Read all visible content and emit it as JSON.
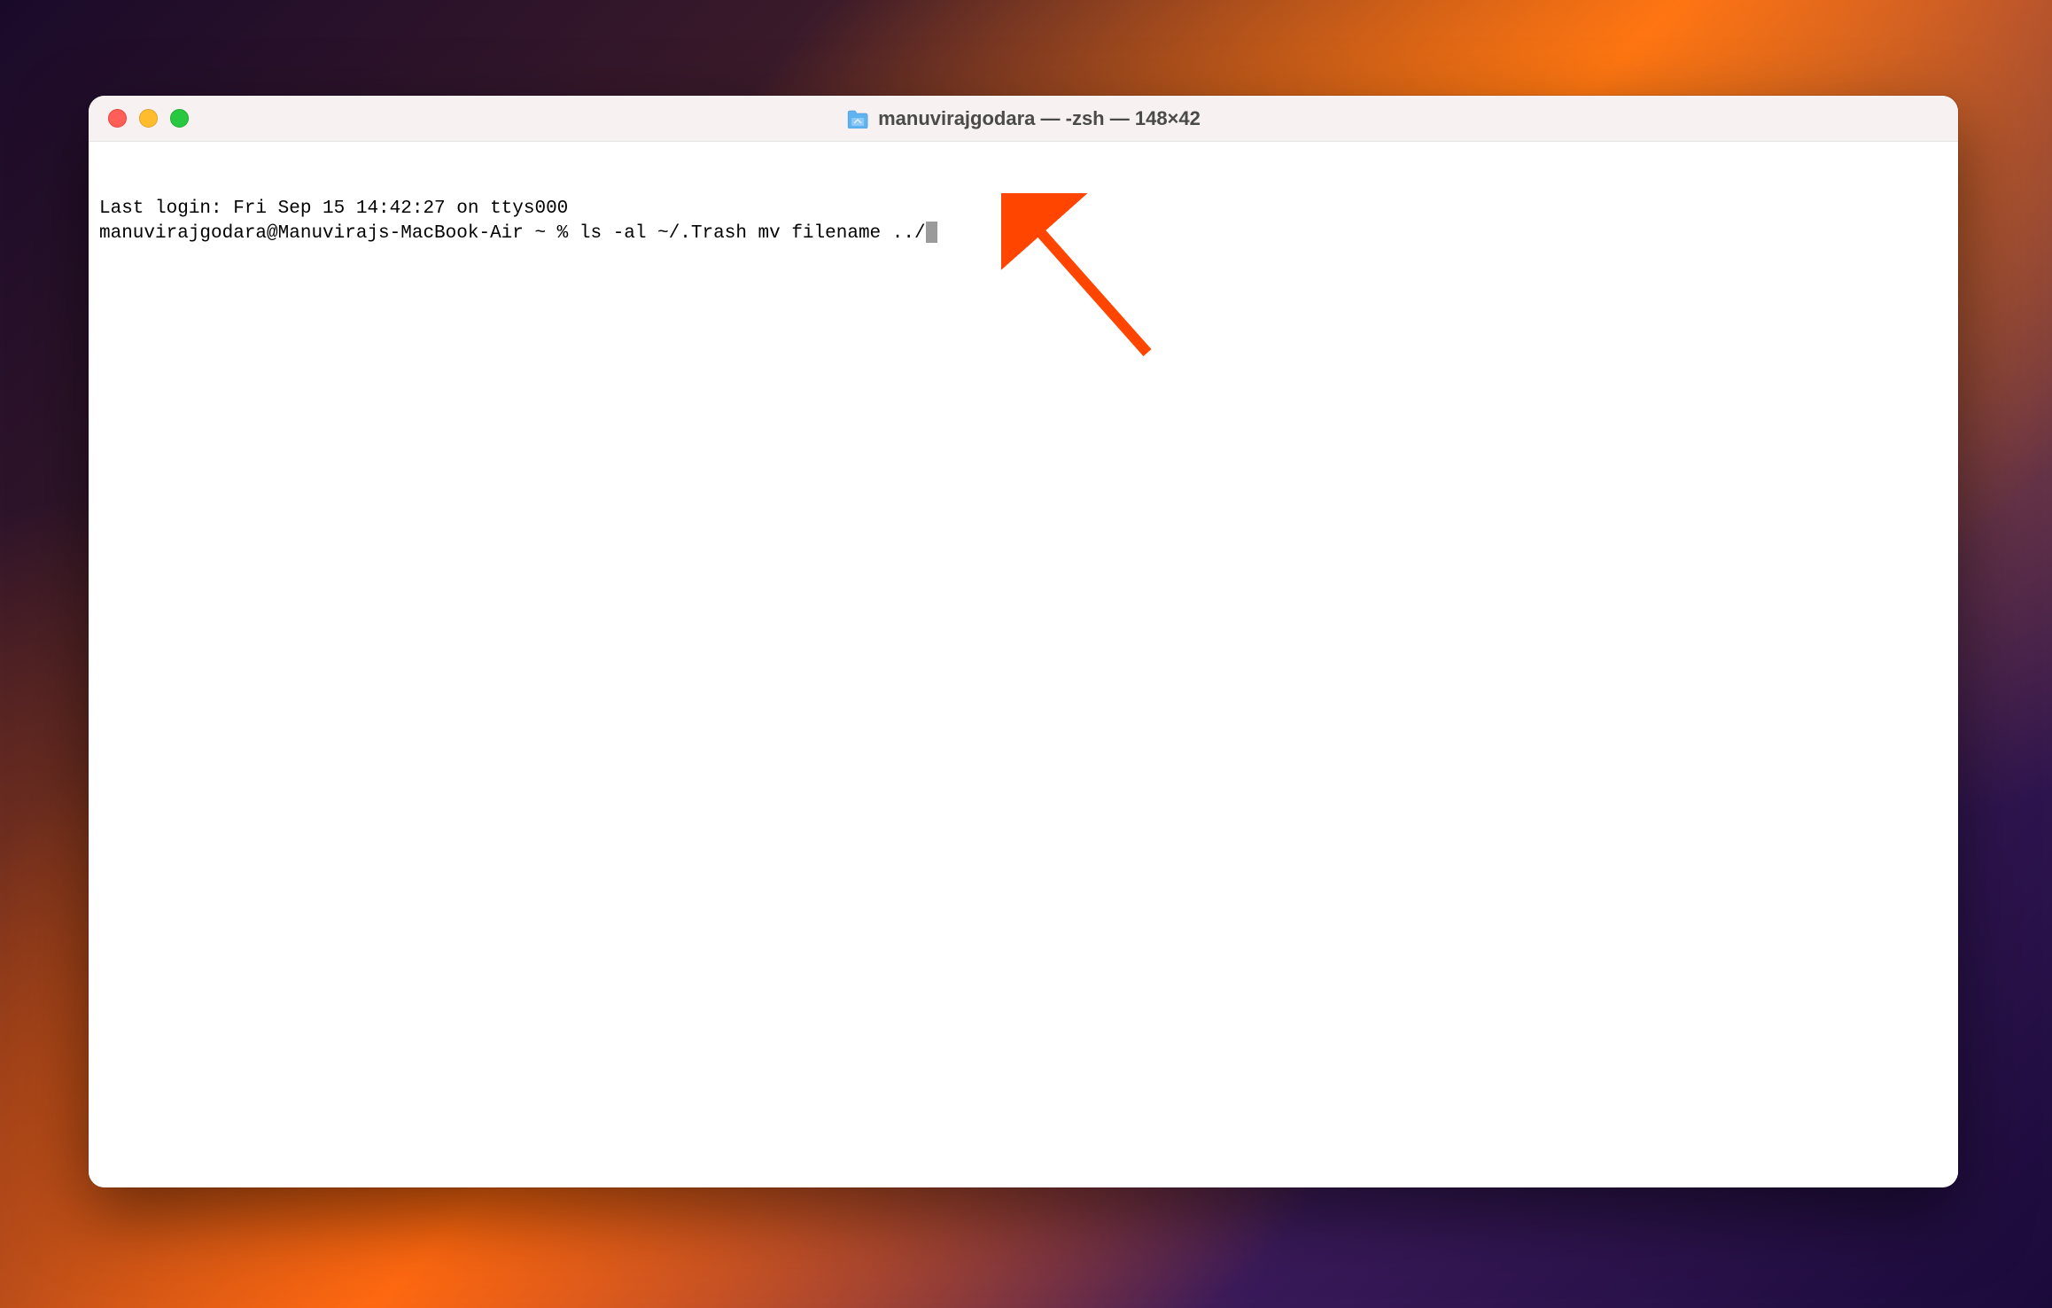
{
  "window": {
    "title": "manuvirajgodara — -zsh — 148×42"
  },
  "terminal": {
    "last_login_line": "Last login: Fri Sep 15 14:42:27 on ttys000",
    "prompt": "manuvirajgodara@Manuvirajs-MacBook-Air ~ % ",
    "command": "ls -al ~/.Trash mv filename ../"
  },
  "colors": {
    "close_button": "#ff5f57",
    "minimize_button": "#ffbd2e",
    "maximize_button": "#28c940",
    "titlebar_bg": "#f8f1f1",
    "terminal_bg": "#ffffff",
    "arrow": "#ff4500"
  }
}
